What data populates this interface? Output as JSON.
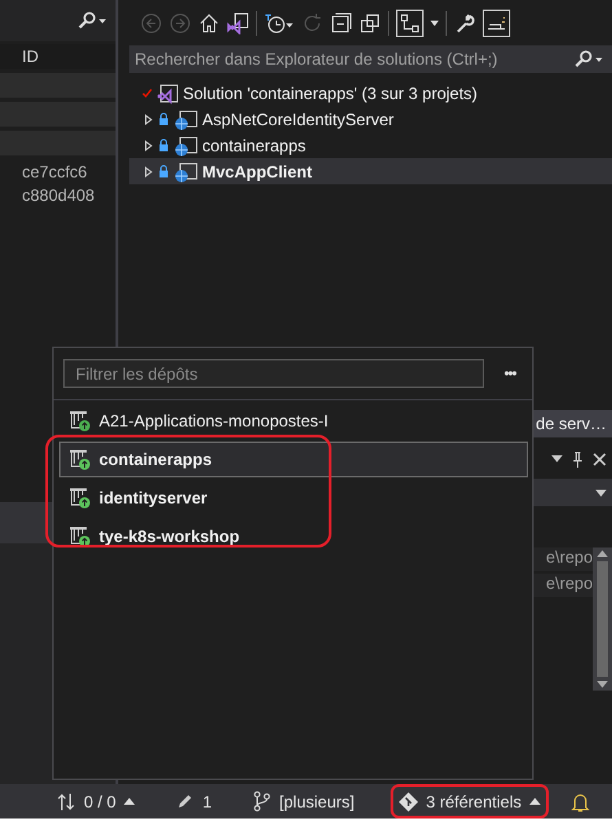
{
  "left_panel": {
    "columns": [
      "ID"
    ],
    "rows": [
      {
        "id": "ce7ccfc6"
      },
      {
        "id": "c880d408"
      }
    ]
  },
  "solution_explorer": {
    "search": {
      "placeholder": "Rechercher dans Explorateur de solutions (Ctrl+;)"
    },
    "tree": [
      {
        "label": "Solution 'containerapps' (3 sur 3 projets)",
        "kind": "solution",
        "children": [
          {
            "label": "AspNetCoreIdentityServer",
            "kind": "project",
            "expanded": false,
            "selected": false,
            "startup": false
          },
          {
            "label": "containerapps",
            "kind": "project",
            "expanded": false,
            "selected": false,
            "startup": false
          },
          {
            "label": "MvcAppClient",
            "kind": "project",
            "expanded": false,
            "selected": true,
            "startup": true
          }
        ]
      }
    ]
  },
  "lower_panel": {
    "tab": "de serv…",
    "rows": [
      "e\\repo",
      "e\\repo"
    ]
  },
  "repo_popup": {
    "filter": {
      "placeholder": "Filtrer les dépôts"
    },
    "more": "•••",
    "repos": [
      {
        "name": "A21-Applications-monopostes-I",
        "selected": false,
        "loaded": false,
        "circled": false
      },
      {
        "name": "containerapps",
        "selected": true,
        "loaded": true,
        "circled": true
      },
      {
        "name": "identityserver",
        "selected": false,
        "loaded": true,
        "circled": true
      },
      {
        "name": "tye-k8s-workshop",
        "selected": false,
        "loaded": true,
        "circled": true
      }
    ]
  },
  "status_bar": {
    "sync": "0 / 0",
    "changes": "1",
    "branch": "[plusieurs]",
    "repos": {
      "label": "3 référentiels",
      "circled": true
    }
  }
}
